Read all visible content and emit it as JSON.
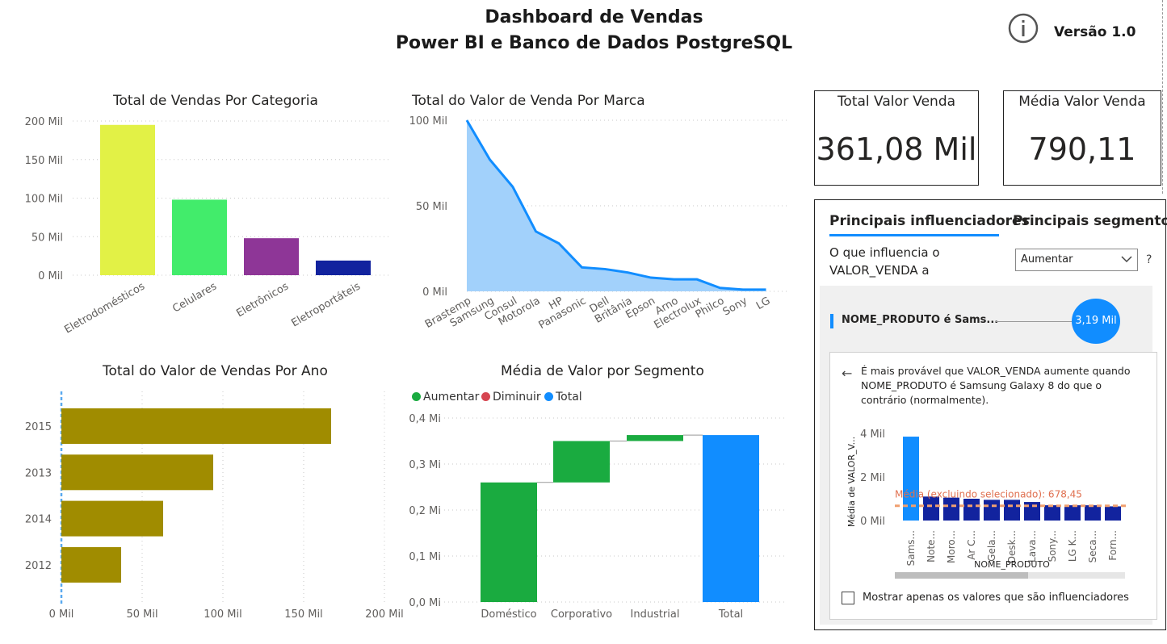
{
  "header": {
    "title_line1": "Dashboard de Vendas",
    "title_line2": "Power BI e Banco de Dados PostgreSQL",
    "version": "Versão 1.0"
  },
  "icons": [
    "info-icon",
    "chevron-down-icon",
    "back-arrow-icon",
    "checkbox-icon"
  ],
  "colors": {
    "accent": "#118dff",
    "navy": "#12239e",
    "olive": "#a08c00",
    "increase": "#1aab40",
    "decrease": "#d64550"
  },
  "cards": {
    "total": {
      "label": "Total Valor Venda",
      "value": "361,08 Mil"
    },
    "media": {
      "label": "Média Valor Venda",
      "value": "790,11"
    }
  },
  "key_influencers": {
    "tab_main": "Principais influenciadores",
    "tab_segments": "Principais segmentos",
    "question_line1": "O que influencia o",
    "question_line2": "VALOR_VENDA a",
    "dropdown_value": "Aumentar",
    "help": "?",
    "influencer_label": "NOME_PRODUTO é Sams...",
    "bubble_value": "3,19 Mil",
    "detail_text": "É mais provável que VALOR_VENDA aumente quando NOME_PRODUTO é Samsung Galaxy 8 do que o contrário (normalmente).",
    "checkbox_label": "Mostrar apenas os valores que são influenciadores"
  },
  "chart_data": [
    {
      "id": "categoria",
      "type": "bar",
      "title": "Total de Vendas Por Categoria",
      "categories": [
        "Eletrodomésticos",
        "Celulares",
        "Eletrônicos",
        "Eletroportáteis"
      ],
      "values": [
        195,
        98,
        48,
        19
      ],
      "unit": "Mil",
      "ylim": [
        0,
        200
      ],
      "yticks": [
        "0 Mil",
        "50 Mil",
        "100 Mil",
        "150 Mil",
        "200 Mil"
      ],
      "colors": [
        "#e2f146",
        "#42ec6b",
        "#8e3697",
        "#12239e"
      ],
      "grid": true
    },
    {
      "id": "marca",
      "type": "area",
      "title": "Total do Valor de Venda Por Marca",
      "categories": [
        "Brastemp",
        "Samsung",
        "Consul",
        "Motorola",
        "HP",
        "Panasonic",
        "Dell",
        "Britânia",
        "Epson",
        "Arno",
        "Electrolux",
        "Philco",
        "Sony",
        "LG"
      ],
      "values": [
        100,
        77,
        61,
        35,
        28,
        14,
        13,
        11,
        8,
        7,
        7,
        2,
        1,
        1
      ],
      "unit": "Mil",
      "ylim": [
        0,
        100
      ],
      "yticks": [
        "0 Mil",
        "50 Mil",
        "100 Mil"
      ],
      "line_color": "#118dff",
      "fill_color": "#a2d1fb",
      "grid": true
    },
    {
      "id": "ano",
      "type": "bar",
      "orientation": "horizontal",
      "title": "Total do Valor de Vendas Por Ano",
      "categories": [
        "2015",
        "2013",
        "2014",
        "2012"
      ],
      "values": [
        167,
        94,
        63,
        37
      ],
      "unit": "Mil",
      "xlim": [
        0,
        200
      ],
      "xticks": [
        "0 Mil",
        "50 Mil",
        "100 Mil",
        "150 Mil",
        "200 Mil"
      ],
      "color": "#a08c00",
      "grid": true
    },
    {
      "id": "segmento",
      "type": "waterfall",
      "title": "Média de Valor por Segmento",
      "legend": [
        "Aumentar",
        "Diminuir",
        "Total"
      ],
      "categories": [
        "Doméstico",
        "Corporativo",
        "Industrial",
        "Total"
      ],
      "values": [
        0.26,
        0.09,
        0.013,
        0.363
      ],
      "unit": "Mi",
      "ylim": [
        0,
        0.4
      ],
      "yticks": [
        "0,0 Mi",
        "0,1 Mi",
        "0,2 Mi",
        "0,3 Mi",
        "0,4 Mi"
      ],
      "colors": {
        "increase": "#1aab40",
        "decrease": "#d64550",
        "total": "#118dff"
      },
      "grid": true
    },
    {
      "id": "produto",
      "type": "bar",
      "title": "",
      "xlabel": "NOME_PRODUTO",
      "ylabel": "Média de VALOR_V...",
      "categories": [
        "Sams...",
        "Note...",
        "Moro...",
        "Ar C...",
        "Gela...",
        "Desk...",
        "Lava...",
        "Sony...",
        "LG K...",
        "Seca...",
        "Forn..."
      ],
      "values": [
        3.85,
        1.1,
        1.05,
        1.0,
        0.95,
        0.95,
        0.85,
        0.7,
        0.7,
        0.7,
        0.65
      ],
      "highlight_index": 0,
      "unit": "Mil",
      "ylim": [
        0,
        4
      ],
      "yticks": [
        "0 Mil",
        "2 Mil",
        "4 Mil"
      ],
      "reference_label": "Média (excluindo selecionado): 678,45",
      "reference_value": 0.678,
      "colors": {
        "highlight": "#118dff",
        "other": "#12239e",
        "reference": "#f0a070"
      }
    }
  ]
}
